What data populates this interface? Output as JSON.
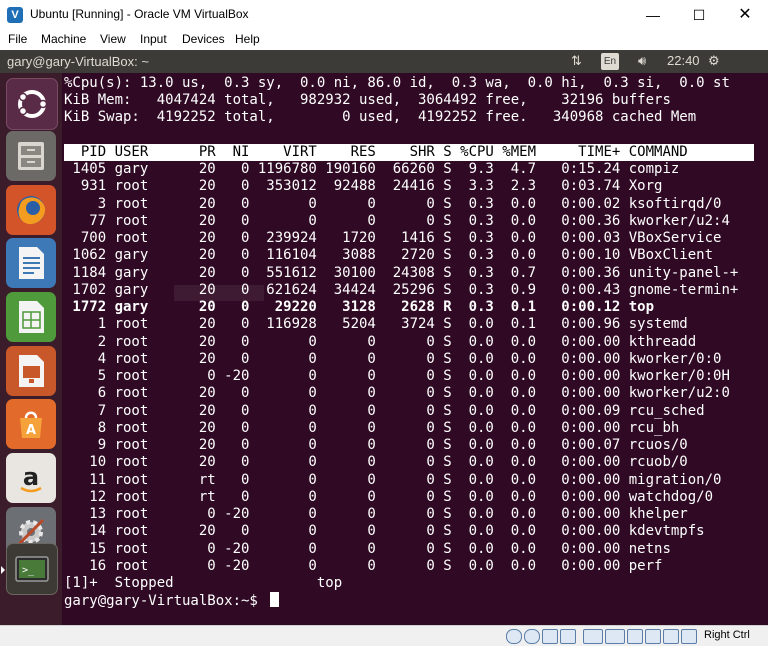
{
  "window": {
    "title": "Ubuntu [Running] - Oracle VM VirtualBox",
    "minimize_glyph": "—",
    "maximize_glyph": "☐",
    "close_glyph": "✕"
  },
  "menubar": [
    "File",
    "Machine",
    "View",
    "Input",
    "Devices",
    "Help"
  ],
  "panel": {
    "title": "gary@gary-VirtualBox: ~",
    "keyboard_layout": "En",
    "clock": "22:40"
  },
  "launcher": {
    "items": [
      "ubuntu-dash",
      "files",
      "firefox",
      "libreoffice-writer",
      "libreoffice-calc",
      "libreoffice-impress",
      "ubuntu-software-center",
      "amazon",
      "system-settings",
      "terminal"
    ]
  },
  "terminal": {
    "lines": [
      "%Cpu(s): 13.0 us,  0.3 sy,  0.0 ni, 86.0 id,  0.3 wa,  0.0 hi,  0.3 si,  0.0 st",
      "KiB Mem:   4047424 total,   982932 used,  3064492 free,    32196 buffers",
      "KiB Swap:  4192252 total,        0 used,  4192252 free.   340968 cached Mem",
      "",
      "  PID USER      PR  NI    VIRT    RES    SHR S %CPU %MEM     TIME+ COMMAND",
      " 1405 gary      20   0 1196780 190160  66260 S  9.3  4.7   0:15.24 compiz",
      "  931 root      20   0  353012  92488  24416 S  3.3  2.3   0:03.74 Xorg",
      "    3 root      20   0       0      0      0 S  0.3  0.0   0:00.02 ksoftirqd/0",
      "   77 root      20   0       0      0      0 S  0.3  0.0   0:00.36 kworker/u2:4",
      "  700 root      20   0  239924   1720   1416 S  0.3  0.0   0:00.03 VBoxService",
      " 1062 gary      20   0  116104   3088   2720 S  0.3  0.0   0:00.10 VBoxClient",
      " 1184 gary      20   0  551612  30100  24308 S  0.3  0.7   0:00.36 unity-panel-+",
      " 1702 gary      20   0  621624  34424  25296 S  0.3  0.9   0:00.43 gnome-termin+",
      " 1772 gary      20   0   29220   3128   2628 R  0.3  0.1   0:00.12 top",
      "    1 root      20   0  116928   5204   3724 S  0.0  0.1   0:00.96 systemd",
      "    2 root      20   0       0      0      0 S  0.0  0.0   0:00.00 kthreadd",
      "    4 root      20   0       0      0      0 S  0.0  0.0   0:00.00 kworker/0:0",
      "    5 root       0 -20       0      0      0 S  0.0  0.0   0:00.00 kworker/0:0H",
      "    6 root      20   0       0      0      0 S  0.0  0.0   0:00.00 kworker/u2:0",
      "    7 root      20   0       0      0      0 S  0.0  0.0   0:00.09 rcu_sched",
      "    8 root      20   0       0      0      0 S  0.0  0.0   0:00.00 rcu_bh",
      "    9 root      20   0       0      0      0 S  0.0  0.0   0:00.07 rcuos/0",
      "   10 root      20   0       0      0      0 S  0.0  0.0   0:00.00 rcuob/0",
      "   11 root      rt   0       0      0      0 S  0.0  0.0   0:00.00 migration/0",
      "   12 root      rt   0       0      0      0 S  0.0  0.0   0:00.00 watchdog/0",
      "   13 root       0 -20       0      0      0 S  0.0  0.0   0:00.00 khelper",
      "   14 root      20   0       0      0      0 S  0.0  0.0   0:00.00 kdevtmpfs",
      "   15 root       0 -20       0      0      0 S  0.0  0.0   0:00.00 netns",
      "   16 root       0 -20       0      0      0 S  0.0  0.0   0:00.00 perf",
      "[1]+  Stopped                 top"
    ],
    "prompt": "gary@gary-VirtualBox:~$ "
  },
  "statusbar": {
    "host_key": "Right Ctrl"
  }
}
